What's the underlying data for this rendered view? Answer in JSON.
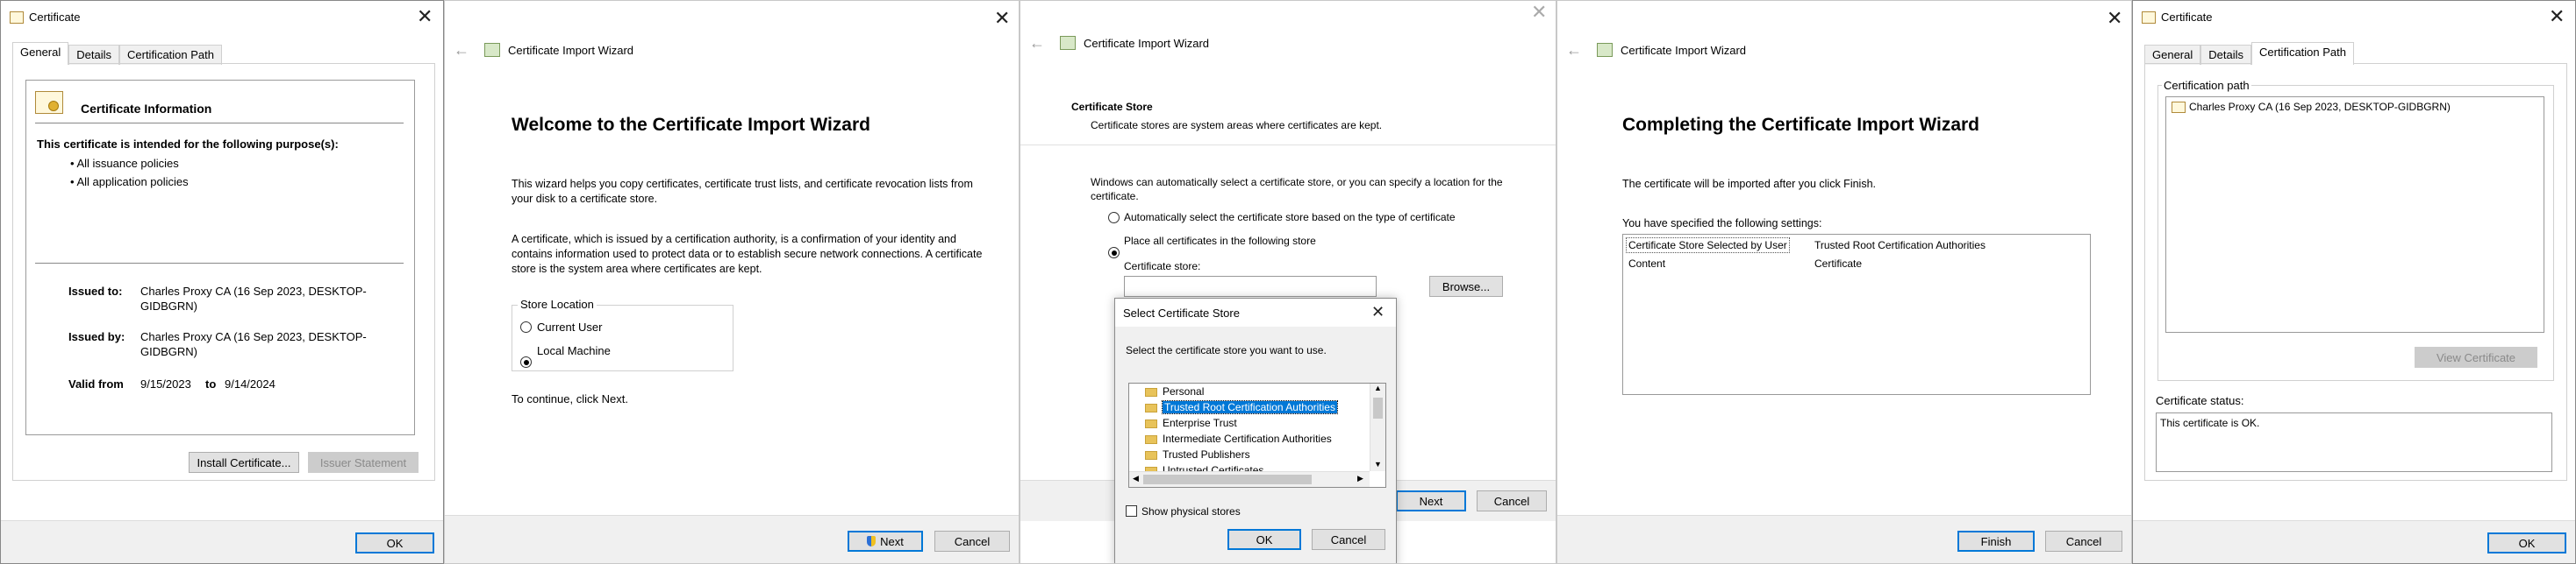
{
  "p1": {
    "title": "Certificate",
    "tabs": [
      "General",
      "Details",
      "Certification Path"
    ],
    "info_heading": "Certificate Information",
    "purpose_heading": "This certificate is intended for the following purpose(s):",
    "purposes": [
      "All issuance policies",
      "All application policies"
    ],
    "issued_to_label": "Issued to:",
    "issued_to_value": "Charles Proxy CA (16 Sep 2023, DESKTOP-GIDBGRN)",
    "issued_by_label": "Issued by:",
    "issued_by_value": "Charles Proxy CA (16 Sep 2023, DESKTOP-GIDBGRN)",
    "valid_from_label": "Valid from",
    "valid_from": "9/15/2023",
    "valid_to_label": "to",
    "valid_to": "9/14/2024",
    "install_button": "Install Certificate...",
    "issuer_statement_button": "Issuer Statement",
    "ok_button": "OK"
  },
  "p2": {
    "title": "Certificate Import Wizard",
    "heading": "Welcome to the Certificate Import Wizard",
    "para1": "This wizard helps you copy certificates, certificate trust lists, and certificate revocation lists from your disk to a certificate store.",
    "para2": "A certificate, which is issued by a certification authority, is a confirmation of your identity and contains information used to protect data or to establish secure network connections. A certificate store is the system area where certificates are kept.",
    "store_location_label": "Store Location",
    "option_current_user": "Current User",
    "option_local_machine": "Local Machine",
    "continue_text": "To continue, click Next.",
    "next_button": "Next",
    "cancel_button": "Cancel"
  },
  "p3": {
    "title": "Certificate Import Wizard",
    "section_title": "Certificate Store",
    "section_sub": "Certificate stores are system areas where certificates are kept.",
    "intro": "Windows can automatically select a certificate store, or you can specify a location for the certificate.",
    "option_auto": "Automatically select the certificate store based on the type of certificate",
    "option_place": "Place all certificates in the following store",
    "store_label": "Certificate store:",
    "browse_button": "Browse...",
    "next_button": "Next",
    "cancel_button": "Cancel",
    "dialog": {
      "title": "Select Certificate Store",
      "prompt": "Select the certificate store you want to use.",
      "stores": [
        "Personal",
        "Trusted Root Certification Authorities",
        "Enterprise Trust",
        "Intermediate Certification Authorities",
        "Trusted Publishers",
        "Untrusted Certificates"
      ],
      "selected_store": "Trusted Root Certification Authorities",
      "show_physical": "Show physical stores",
      "ok_button": "OK",
      "cancel_button": "Cancel"
    }
  },
  "p4": {
    "title": "Certificate Import Wizard",
    "heading": "Completing the Certificate Import Wizard",
    "para1": "The certificate will be imported after you click Finish.",
    "para2": "You have specified the following settings:",
    "settings": [
      {
        "key": "Certificate Store Selected by User",
        "value": "Trusted Root Certification Authorities"
      },
      {
        "key": "Content",
        "value": "Certificate"
      }
    ],
    "finish_button": "Finish",
    "cancel_button": "Cancel"
  },
  "p5": {
    "title": "Certificate",
    "tabs": [
      "General",
      "Details",
      "Certification Path"
    ],
    "path_label": "Certification path",
    "path_item": "Charles Proxy CA (16 Sep 2023, DESKTOP-GIDBGRN)",
    "view_button": "View Certificate",
    "status_label": "Certificate status:",
    "status_text": "This certificate is OK.",
    "ok_button": "OK"
  },
  "colors": {
    "accent": "#0078d7",
    "selection": "#0078d7",
    "heading_blue": "#003399",
    "footer": "#f0f0f0"
  }
}
